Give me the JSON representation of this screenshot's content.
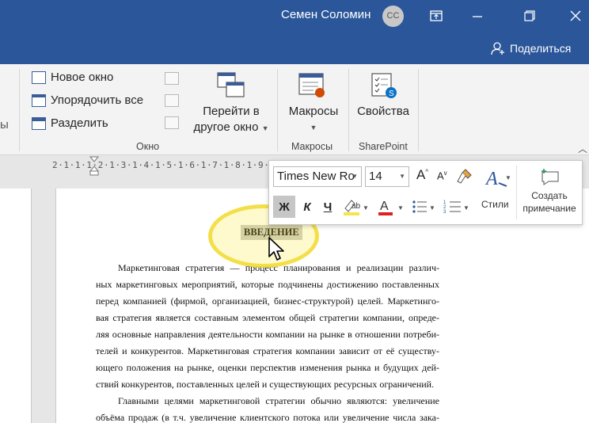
{
  "titlebar": {
    "user_name": "Семен Соломин",
    "avatar_initials": "СС",
    "share_label": "Поделиться"
  },
  "ribbon": {
    "window_group": {
      "new_window": "Новое окно",
      "arrange_all": "Упорядочить все",
      "split": "Разделить",
      "switch_windows_line1": "Перейти в",
      "switch_windows_line2": "другое окно",
      "label": "Окно"
    },
    "macros_group": {
      "macros": "Макросы",
      "label": "Макросы"
    },
    "sharepoint_group": {
      "properties": "Свойства",
      "label": "SharePoint"
    }
  },
  "ruler": {
    "text": "2·1·1·1·2·1·3·1·4·1·5·1·6·1·7·1·8·1·9·1·10·1·11·1·12·"
  },
  "mini_toolbar": {
    "font_name": "Times New Ro",
    "font_size": "14",
    "grow_font": "A",
    "shrink_font": "A",
    "bold": "Ж",
    "italic": "К",
    "underline": "Ч",
    "styles": "Стили",
    "new_comment_line1": "Создать",
    "new_comment_line2": "примечание",
    "colors": {
      "highlight": "#f4e64a",
      "font_color": "#e02020"
    }
  },
  "document": {
    "heading": "ВВЕДЕНИЕ",
    "lines": [
      "Маркетинговая стратегия — процесс планирования и реализации различ-",
      "ных маркетинговых мероприятий, которые подчинены достижению поставленных",
      "перед компанией (фирмой, организацией, бизнес-структурой) целей. Маркетинго-",
      "вая стратегия является составным элементом общей стратегии компании, опреде-",
      "ляя основные направления деятельности компании на рынке в отношении потреби-",
      "телей и конкурентов. Маркетинговая стратегия компании зависит от её существу-",
      "ющего положения на рынке, оценки перспектив изменения рынка и будущих дей-",
      "ствий конкурентов, поставленных целей и существующих ресурсных ограничений.",
      "Главными целями маркетинговой стратегии обычно являются: увеличение",
      "объёма продаж (в т.ч. увеличение клиентского потока или увеличение числа зака-"
    ]
  },
  "colors": {
    "title_bar": "#2b579a",
    "ribbon": "#f3f3f3",
    "canvas": "#e6e6e6"
  }
}
